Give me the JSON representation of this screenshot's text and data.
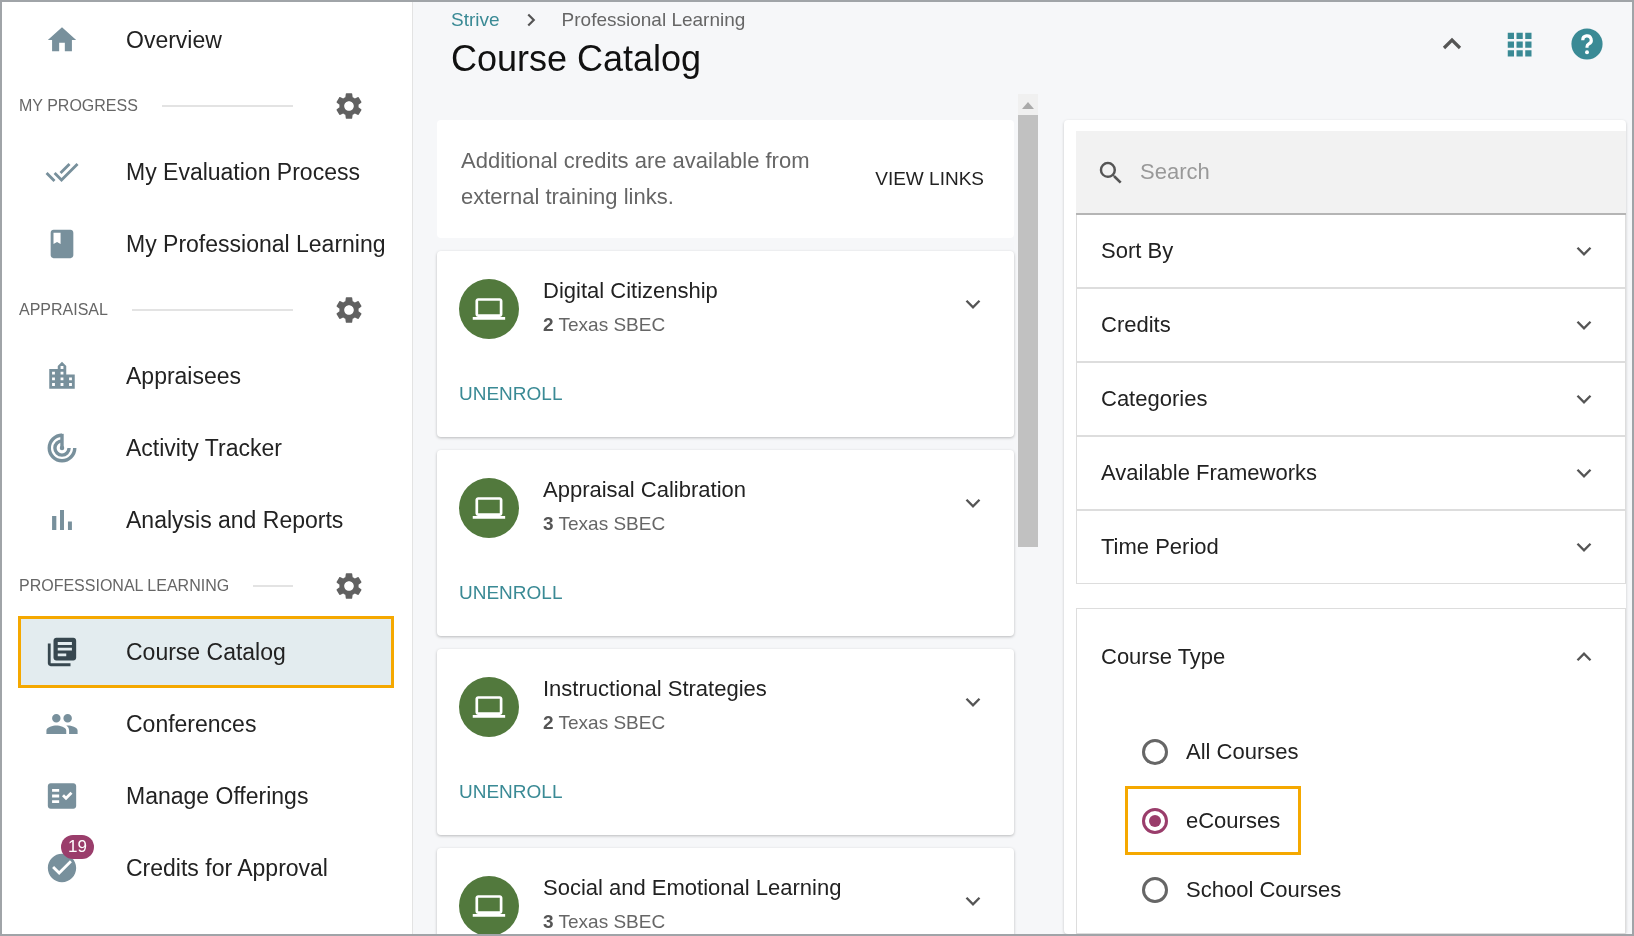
{
  "sidebar": {
    "items": [
      {
        "kind": "link",
        "label": "Overview",
        "selected": false
      },
      {
        "kind": "section",
        "label": "MY PROGRESS"
      },
      {
        "kind": "link",
        "label": "My Evaluation Process",
        "selected": false
      },
      {
        "kind": "link",
        "label": "My Professional Learning",
        "selected": false
      },
      {
        "kind": "section",
        "label": "APPRAISAL"
      },
      {
        "kind": "link",
        "label": "Appraisees",
        "selected": false
      },
      {
        "kind": "link",
        "label": "Activity Tracker",
        "selected": false
      },
      {
        "kind": "link",
        "label": "Analysis and Reports",
        "selected": false
      },
      {
        "kind": "section",
        "label": "PROFESSIONAL LEARNING"
      },
      {
        "kind": "link",
        "label": "Course Catalog",
        "selected": true
      },
      {
        "kind": "link",
        "label": "Conferences",
        "selected": false
      },
      {
        "kind": "link",
        "label": "Manage Offerings",
        "selected": false
      },
      {
        "kind": "link",
        "label": "Credits for Approval",
        "selected": false,
        "badge": "19"
      }
    ]
  },
  "header": {
    "breadcrumbs": [
      "Strive",
      "Professional Learning"
    ],
    "title": "Course Catalog"
  },
  "notice": {
    "text": "Additional credits are available from external training links.",
    "action": "VIEW LINKS"
  },
  "courses": [
    {
      "title": "Digital Citizenship",
      "credits": "**2** Texas SBEC",
      "action": "UNENROLL"
    },
    {
      "title": "Appraisal Calibration",
      "credits": "**3** Texas SBEC",
      "action": "UNENROLL"
    },
    {
      "title": "Instructional Strategies",
      "credits": "**2** Texas SBEC",
      "action": "UNENROLL"
    },
    {
      "title": "Social and Emotional Learning",
      "credits": "**3** Texas SBEC"
    }
  ],
  "filters": {
    "search": {
      "placeholder": "Search"
    },
    "sections": [
      {
        "label": "Sort By",
        "expanded": false
      },
      {
        "label": "Credits",
        "expanded": false
      },
      {
        "label": "Categories",
        "expanded": false
      },
      {
        "label": "Available Frameworks",
        "expanded": false
      },
      {
        "label": "Time Period",
        "expanded": false
      }
    ],
    "course_type": {
      "label": "Course Type",
      "expanded": true,
      "options": [
        {
          "label": "All Courses",
          "selected": false
        },
        {
          "label": "eCourses",
          "selected": true
        },
        {
          "label": "School Courses",
          "selected": false
        }
      ]
    }
  }
}
